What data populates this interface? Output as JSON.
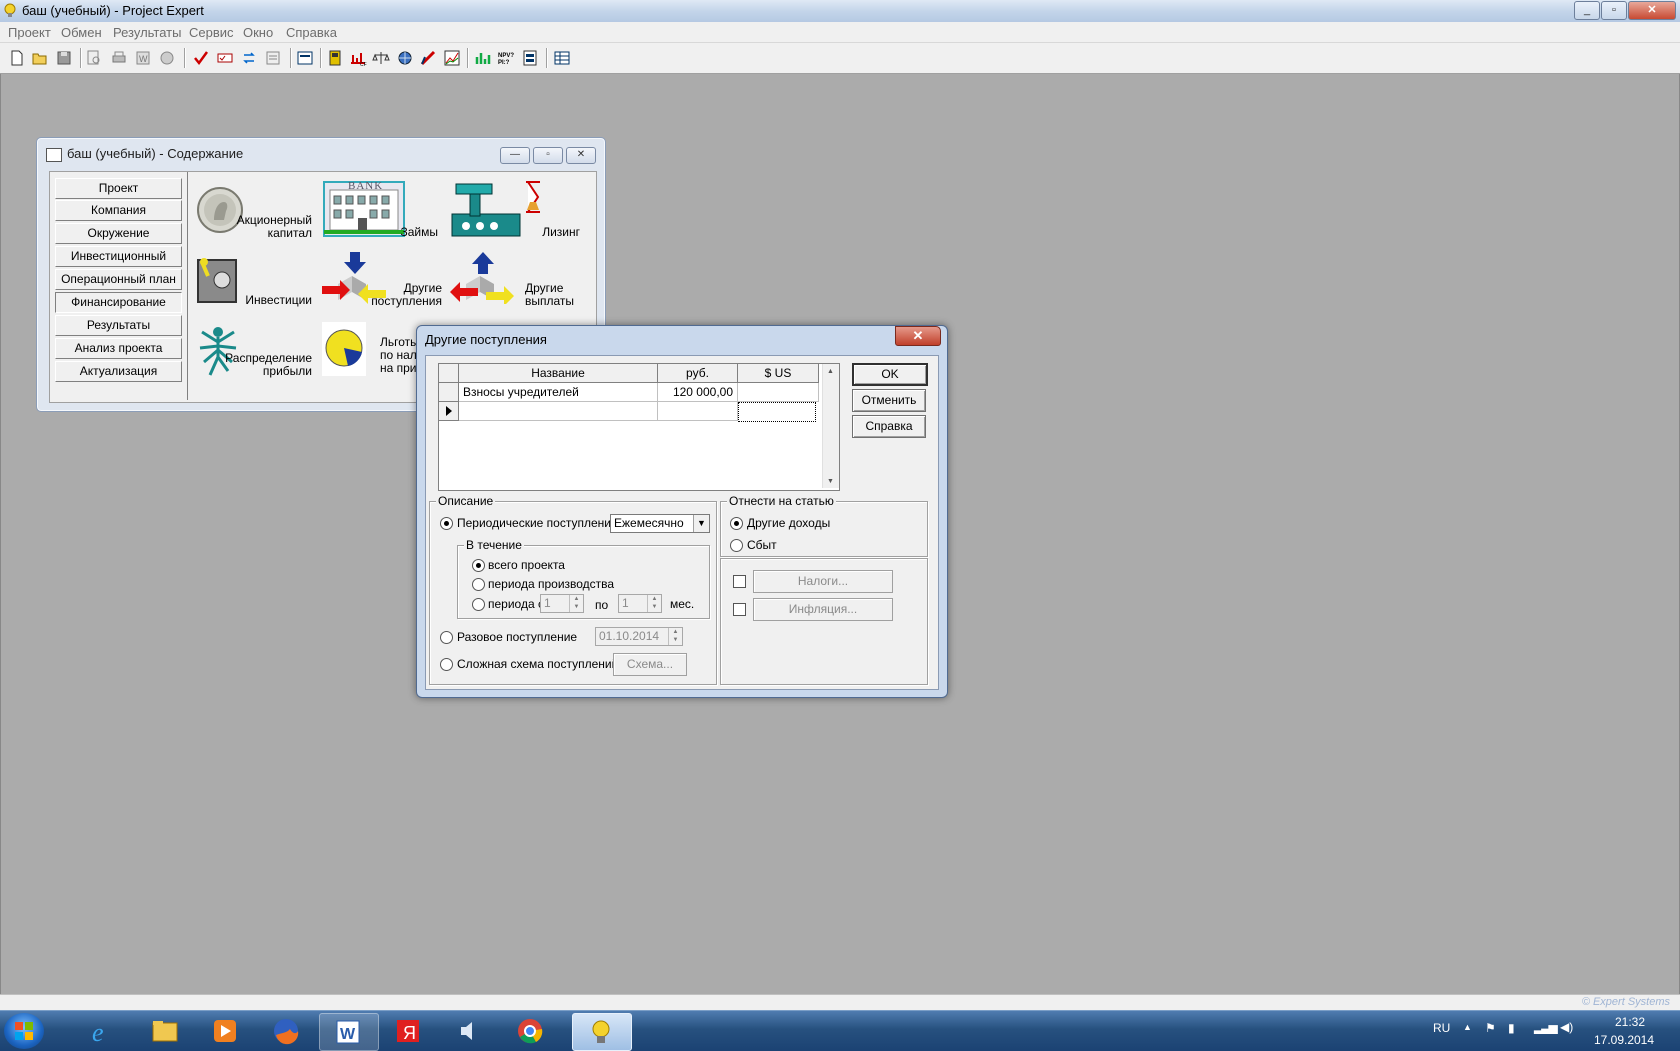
{
  "app": {
    "title": "баш (учебный) - Project Expert",
    "window_controls": [
      "_",
      "▫",
      "✕"
    ]
  },
  "menu": [
    "Проект",
    "Обмен",
    "Результаты",
    "Сервис",
    "Окно",
    "Справка"
  ],
  "toolbar_icons": [
    "new-file-icon",
    "open-folder-icon",
    "save-icon",
    "preview-icon",
    "print-icon",
    "word-export-icon",
    "report-icon",
    "check-icon",
    "calc-icon",
    "loop-icon",
    "notes-icon",
    "list-icon",
    "calendar-icon",
    "cashflow-icon",
    "scales-icon",
    "globe-icon",
    "ruler-icon",
    "chart-icon",
    "bars-icon",
    "npv-icon",
    "structure-icon",
    "table-icon"
  ],
  "contents_window": {
    "title": "баш (учебный) - Содержание",
    "nav": [
      {
        "label": "Проект"
      },
      {
        "label": "Компания"
      },
      {
        "label": "Окружение"
      },
      {
        "label": "Инвестиционный план"
      },
      {
        "label": "Операционный план"
      },
      {
        "label": "Финансирование",
        "active": true
      },
      {
        "label": "Результаты"
      },
      {
        "label": "Анализ проекта"
      },
      {
        "label": "Актуализация"
      }
    ],
    "items": {
      "equity": "Акционерный\nкапитал",
      "loans": "Займы",
      "bank_sign": "BANK",
      "leasing": "Лизинг",
      "investments": "Инвестиции",
      "other_income": "Другие\nпоступления",
      "other_payments": "Другие\nвыплаты",
      "profit_distribution": "Распределение\nприбыли",
      "tax_benefits": "Льготы\nпо нало\nна при"
    }
  },
  "dialog": {
    "title": "Другие поступления",
    "grid": {
      "columns": [
        "Название",
        "руб.",
        "$ US"
      ],
      "rows": [
        {
          "name": "Взносы учредителей",
          "rub": "120 000,00",
          "usd": ""
        },
        {
          "name": "",
          "rub": "",
          "usd": ""
        }
      ]
    },
    "buttons": {
      "ok": "OK",
      "cancel": "Отменить",
      "help": "Справка"
    },
    "description": {
      "label": "Описание",
      "periodic": "Периодические поступления",
      "periodicity": "Ежемесячно",
      "during": {
        "label": "В течение",
        "whole": "всего проекта",
        "production": "периода производства",
        "period_from": "периода с",
        "from_value": "1",
        "to_label": "по",
        "to_value": "1",
        "months": "мес."
      },
      "one_time": "Разовое поступление",
      "one_time_date": "01.10.2014",
      "complex": "Сложная схема поступлений",
      "scheme_button": "Схема..."
    },
    "assign": {
      "label": "Отнести на статью",
      "other_income": "Другие доходы",
      "sales": "Сбыт",
      "taxes_button": "Налоги...",
      "inflation_button": "Инфляция..."
    }
  },
  "status": {
    "brand": "© Expert Systems"
  },
  "taskbar": {
    "apps": [
      "ie-icon",
      "explorer-icon",
      "media-player-icon",
      "firefox-icon",
      "word-icon",
      "yandex-icon",
      "speaker-app-icon",
      "chrome-icon",
      "project-expert-icon"
    ],
    "lang": "RU",
    "time": "21:32",
    "date": "17.09.2014"
  },
  "colors": {
    "window_frame": "#c9d8ec",
    "close_red": "#c0402a",
    "taskbar": "#27517f"
  }
}
